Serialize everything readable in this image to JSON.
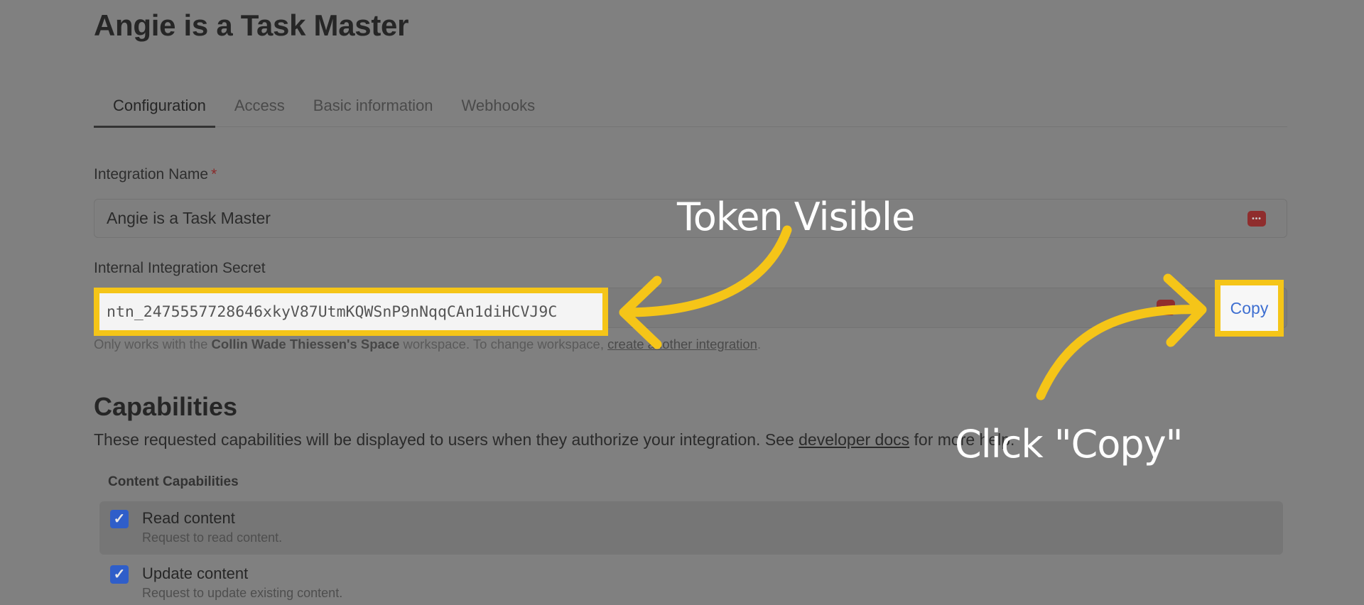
{
  "page": {
    "title": "Angie is a Task Master"
  },
  "tabs": [
    {
      "label": "Configuration",
      "active": true
    },
    {
      "label": "Access",
      "active": false
    },
    {
      "label": "Basic information",
      "active": false
    },
    {
      "label": "Webhooks",
      "active": false
    }
  ],
  "integration_name": {
    "label": "Integration Name",
    "required_marker": "*",
    "value": "Angie is a Task Master"
  },
  "secret": {
    "label": "Internal Integration Secret",
    "value": "ntn_2475557728646xkyV87UtmKQWSnP9nNqqCAn1diHCVJ9C",
    "copy_label": "Copy"
  },
  "helper": {
    "prefix": "Only works with the ",
    "workspace": "Collin Wade Thiessen's Space",
    "middle": " workspace. To change workspace, ",
    "link": "create another integration",
    "suffix": "."
  },
  "capabilities": {
    "title": "Capabilities",
    "desc_prefix": "These requested capabilities will be displayed to users when they authorize your integration. See ",
    "desc_link": "developer docs",
    "desc_suffix": " for more help.",
    "group_label": "Content Capabilities",
    "items": [
      {
        "title": "Read content",
        "desc": "Request to read content.",
        "checked": true
      },
      {
        "title": "Update content",
        "desc": "Request to update existing content.",
        "checked": true
      }
    ]
  },
  "annotations": {
    "token": "Token Visible",
    "copy": "Click \"Copy\""
  },
  "colors": {
    "highlight": "#f5c518",
    "accent": "#3e6fd1",
    "overlay": "#808080"
  }
}
